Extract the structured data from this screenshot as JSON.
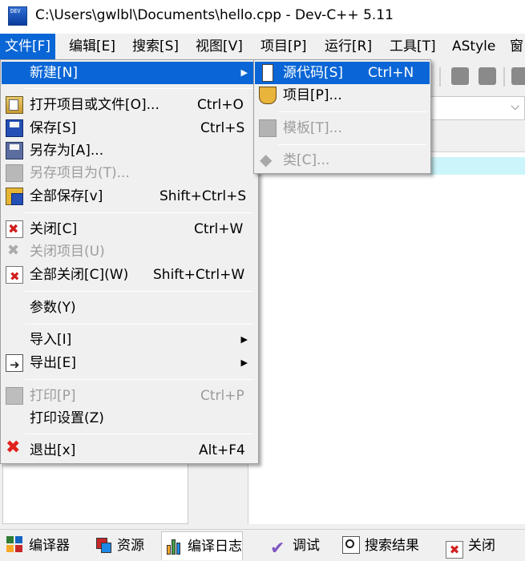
{
  "window": {
    "title": "C:\\Users\\gwlbl\\Documents\\hello.cpp - Dev-C++ 5.11",
    "icon": "dev-cpp-app-icon",
    "icon_text": "DEV"
  },
  "menubar": {
    "items": [
      "文件[F]",
      "编辑[E]",
      "搜索[S]",
      "视图[V]",
      "项目[P]",
      "运行[R]",
      "工具[T]",
      "AStyle",
      "窗"
    ],
    "active_index": 0
  },
  "file_menu": {
    "items": [
      {
        "label": "新建[N]",
        "shortcut": "",
        "icon": "",
        "submenu": true,
        "highlighted": true,
        "disabled": false
      },
      {
        "label": "打开项目或文件[O]...",
        "shortcut": "Ctrl+O",
        "icon": "open-icon",
        "disabled": false
      },
      {
        "label": "保存[S]",
        "shortcut": "Ctrl+S",
        "icon": "save-icon",
        "disabled": false
      },
      {
        "label": "另存为[A]...",
        "shortcut": "",
        "icon": "save-as-icon",
        "disabled": false
      },
      {
        "label": "另存项目为(T)...",
        "shortcut": "",
        "icon": "save-project-icon",
        "disabled": true
      },
      {
        "label": "全部保存[v]",
        "shortcut": "Shift+Ctrl+S",
        "icon": "save-all-icon",
        "disabled": false
      },
      {
        "label": "关闭[C]",
        "shortcut": "Ctrl+W",
        "icon": "close-file-icon",
        "disabled": false
      },
      {
        "label": "关闭项目(U)",
        "shortcut": "",
        "icon": "close-project-icon",
        "disabled": true
      },
      {
        "label": "全部关闭[C](W)",
        "shortcut": "Shift+Ctrl+W",
        "icon": "close-all-icon",
        "disabled": false
      },
      {
        "label": "参数(Y)",
        "shortcut": "",
        "icon": "",
        "disabled": false
      },
      {
        "label": "导入[I]",
        "shortcut": "",
        "icon": "",
        "submenu": true,
        "disabled": false
      },
      {
        "label": "导出[E]",
        "shortcut": "",
        "icon": "export-icon",
        "submenu": true,
        "disabled": false
      },
      {
        "label": "打印[P]",
        "shortcut": "Ctrl+P",
        "icon": "print-icon",
        "disabled": true
      },
      {
        "label": "打印设置(Z)",
        "shortcut": "",
        "icon": "",
        "disabled": false
      },
      {
        "label": "退出[x]",
        "shortcut": "Alt+F4",
        "icon": "exit-icon",
        "disabled": false
      }
    ]
  },
  "new_submenu": {
    "items": [
      {
        "label": "源代码[S]",
        "shortcut": "Ctrl+N",
        "icon": "source-file-icon",
        "highlighted": true,
        "disabled": false
      },
      {
        "label": "项目[P]...",
        "shortcut": "",
        "icon": "project-icon",
        "disabled": false
      },
      {
        "label": "模板[T]...",
        "shortcut": "",
        "icon": "template-icon",
        "disabled": true
      },
      {
        "label": "类[C]...",
        "shortcut": "",
        "icon": "class-icon",
        "disabled": true
      }
    ]
  },
  "bottom_tabs": [
    {
      "label": "编译器",
      "icon": "compiler-grid-icon"
    },
    {
      "label": "资源",
      "icon": "resources-icon"
    },
    {
      "label": "编译日志",
      "icon": "bar-chart-icon",
      "active": true
    },
    {
      "label": "调试",
      "icon": "checkmark-icon"
    },
    {
      "label": "搜索结果",
      "icon": "magnifier-icon"
    },
    {
      "label": "关闭",
      "icon": "close-panel-icon"
    }
  ],
  "colors": {
    "highlight": "#0a66d6",
    "menu_background": "#f0f0f0",
    "disabled_text": "#9c9c9c",
    "editor_current_line": "#ccf5fb"
  }
}
